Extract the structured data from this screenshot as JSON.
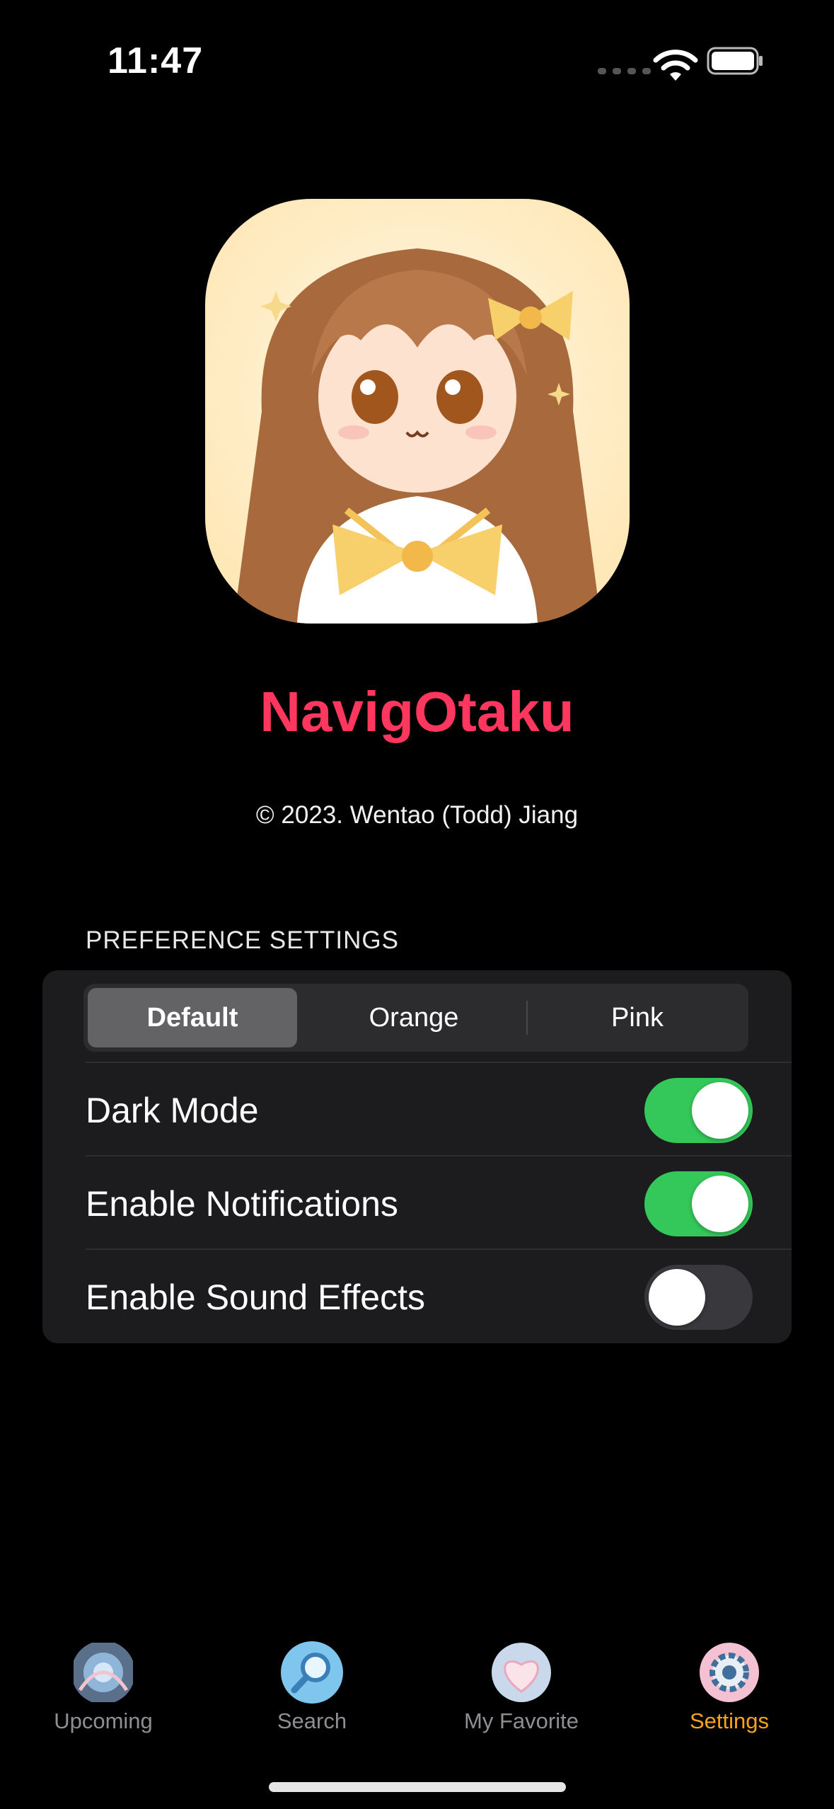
{
  "status_bar": {
    "time": "11:47"
  },
  "app": {
    "name": "NavigOtaku",
    "copyright": "© 2023. Wentao (Todd) Jiang"
  },
  "preferences": {
    "header": "PREFERENCE SETTINGS",
    "theme_options": [
      "Default",
      "Orange",
      "Pink"
    ],
    "selected_theme": "Default",
    "toggles": [
      {
        "label": "Dark Mode",
        "on": true
      },
      {
        "label": "Enable Notifications",
        "on": true
      },
      {
        "label": "Enable Sound Effects",
        "on": false
      }
    ]
  },
  "tab_bar": {
    "tabs": [
      {
        "label": "Upcoming",
        "icon": "upcoming-icon"
      },
      {
        "label": "Search",
        "icon": "search-icon"
      },
      {
        "label": "My Favorite",
        "icon": "heart-icon"
      },
      {
        "label": "Settings",
        "icon": "gear-icon"
      }
    ],
    "active": "Settings"
  },
  "colors": {
    "accent": "#ff375f",
    "toggle_on": "#34c759",
    "active_tab": "#f7a31b",
    "background": "#000000",
    "card": "#1c1c1e"
  }
}
